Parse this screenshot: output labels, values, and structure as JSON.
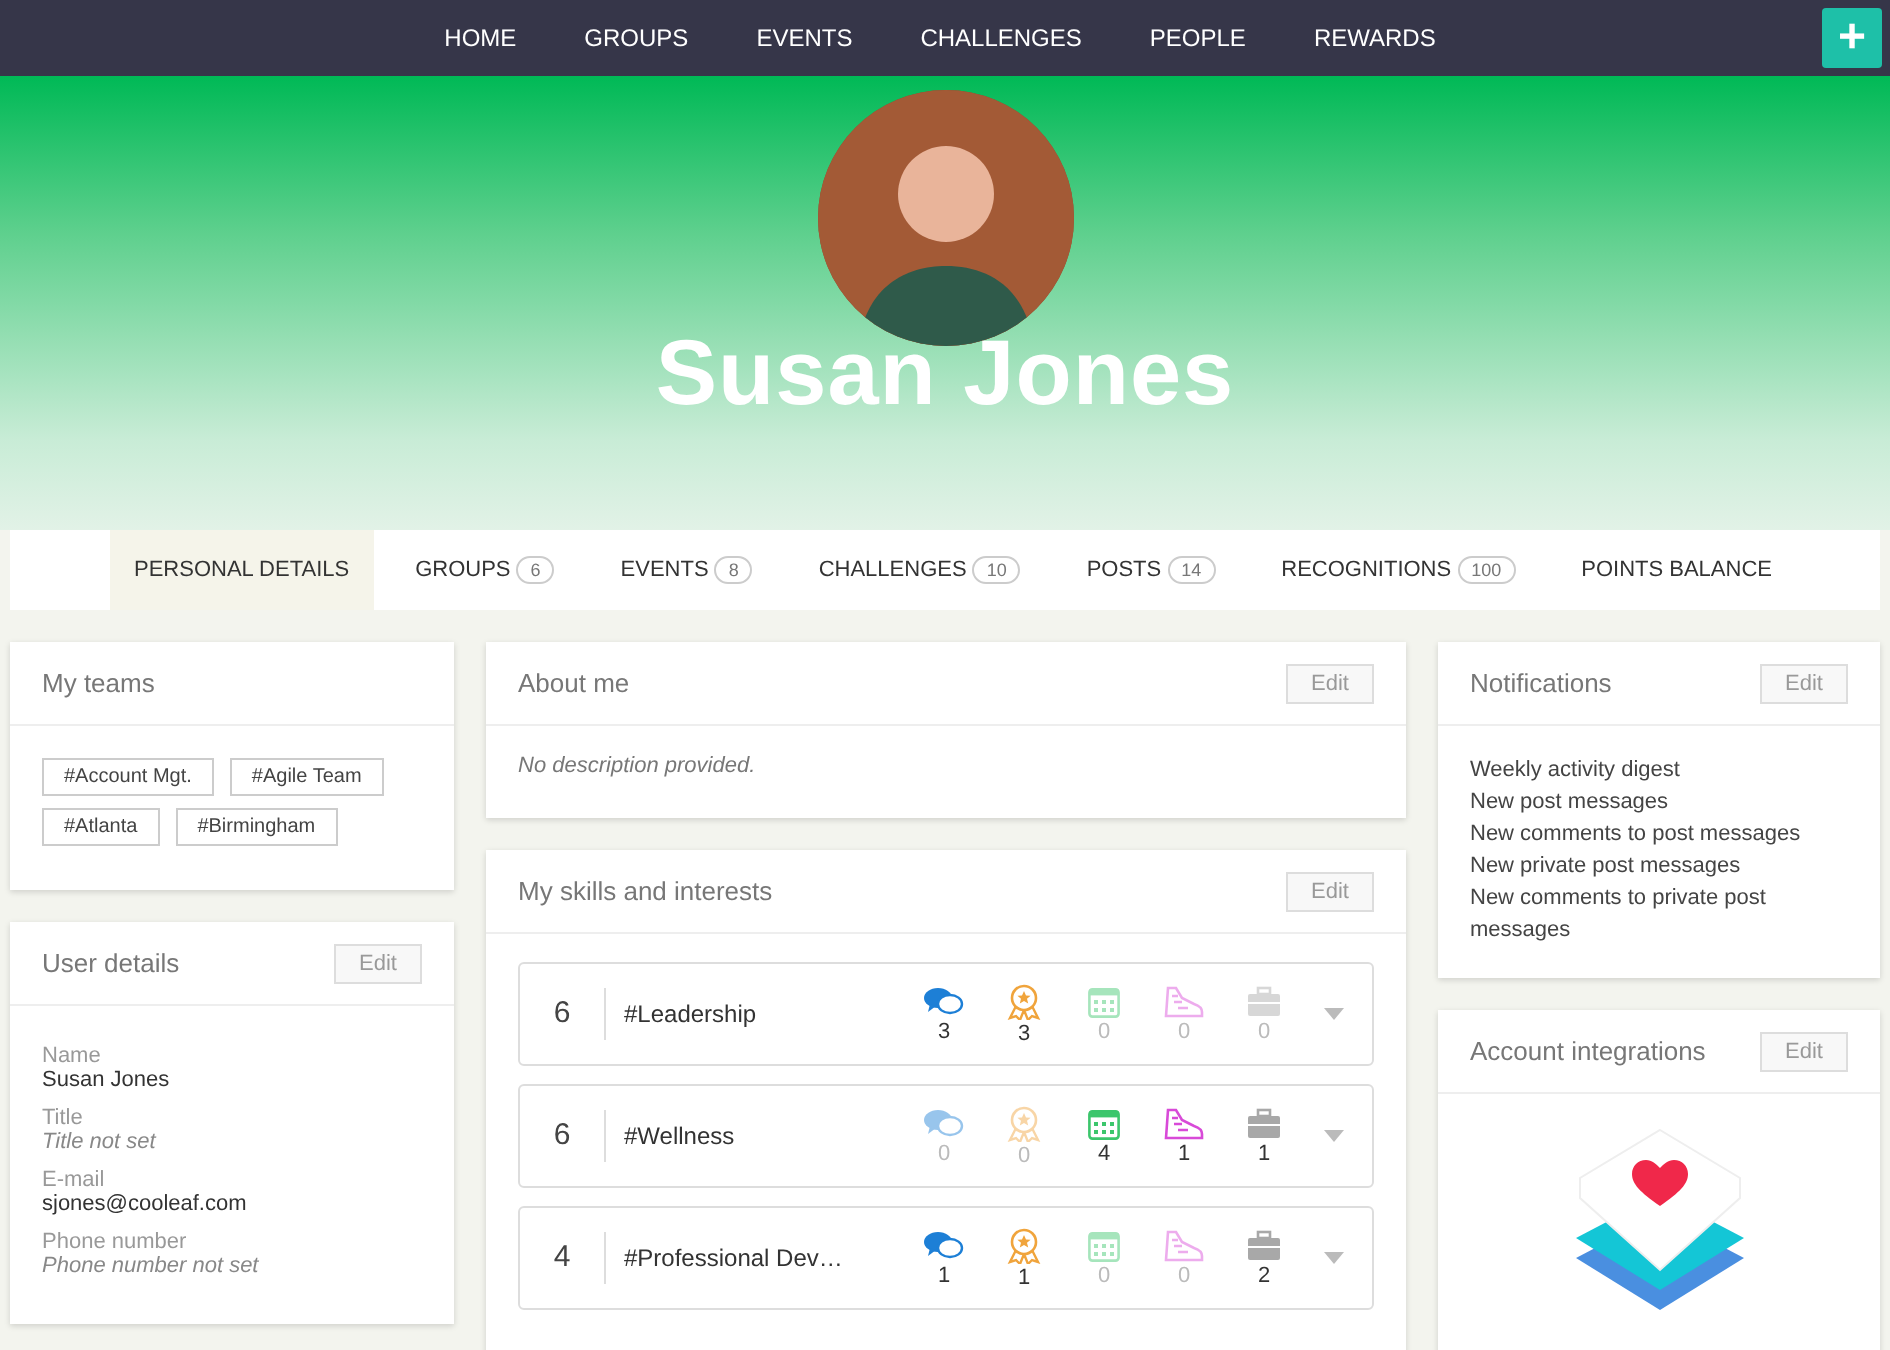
{
  "nav": {
    "items": [
      {
        "label": "HOME"
      },
      {
        "label": "GROUPS"
      },
      {
        "label": "EVENTS"
      },
      {
        "label": "CHALLENGES"
      },
      {
        "label": "PEOPLE"
      },
      {
        "label": "REWARDS"
      }
    ],
    "add_button": "+"
  },
  "profile": {
    "name": "Susan Jones"
  },
  "tabs": [
    {
      "label": "PERSONAL DETAILS",
      "selected": true
    },
    {
      "label": "GROUPS",
      "count": "6",
      "selected": false
    },
    {
      "label": "EVENTS",
      "count": "8",
      "selected": false
    },
    {
      "label": "CHALLENGES",
      "count": "10",
      "selected": false
    },
    {
      "label": "POSTS",
      "count": "14",
      "selected": false
    },
    {
      "label": "RECOGNITIONS",
      "count": "100",
      "selected": false
    },
    {
      "label": "POINTS BALANCE",
      "selected": false
    }
  ],
  "my_teams": {
    "title": "My teams",
    "tags": [
      "#Account Mgt.",
      "#Agile Team",
      "#Atlanta",
      "#Birmingham"
    ]
  },
  "user_details": {
    "title": "User details",
    "edit": "Edit",
    "fields": [
      {
        "label": "Name",
        "value": "Susan Jones",
        "is_set": true
      },
      {
        "label": "Title",
        "value": "Title not set",
        "is_set": false
      },
      {
        "label": "E-mail",
        "value": "sjones@cooleaf.com",
        "is_set": true
      },
      {
        "label": "Phone number",
        "value": "Phone number not set",
        "is_set": false
      }
    ]
  },
  "about_me": {
    "title": "About me",
    "edit": "Edit",
    "text": "No description provided."
  },
  "skills": {
    "title": "My skills and interests",
    "edit": "Edit",
    "rows": [
      {
        "score": "6",
        "name": "#Leadership",
        "stats": [
          {
            "kind": "posts",
            "count": "3",
            "active": true
          },
          {
            "kind": "recognitions",
            "count": "3",
            "active": true
          },
          {
            "kind": "events",
            "count": "0",
            "active": false
          },
          {
            "kind": "challenges",
            "count": "0",
            "active": false
          },
          {
            "kind": "groups",
            "count": "0",
            "active": false
          }
        ]
      },
      {
        "score": "6",
        "name": "#Wellness",
        "stats": [
          {
            "kind": "posts",
            "count": "0",
            "active": false
          },
          {
            "kind": "recognitions",
            "count": "0",
            "active": false
          },
          {
            "kind": "events",
            "count": "4",
            "active": true
          },
          {
            "kind": "challenges",
            "count": "1",
            "active": true
          },
          {
            "kind": "groups",
            "count": "1",
            "active": true
          }
        ]
      },
      {
        "score": "4",
        "name": "#Professional Dev…",
        "stats": [
          {
            "kind": "posts",
            "count": "1",
            "active": true
          },
          {
            "kind": "recognitions",
            "count": "1",
            "active": true
          },
          {
            "kind": "events",
            "count": "0",
            "active": false
          },
          {
            "kind": "challenges",
            "count": "0",
            "active": false
          },
          {
            "kind": "groups",
            "count": "2",
            "active": true
          }
        ]
      }
    ]
  },
  "notifications": {
    "title": "Notifications",
    "edit": "Edit",
    "items": [
      "Weekly activity digest",
      "New post messages",
      "New comments to post messages",
      "New private post messages",
      "New comments to private post messages"
    ]
  },
  "account_integrations": {
    "title": "Account integrations",
    "edit": "Edit"
  }
}
